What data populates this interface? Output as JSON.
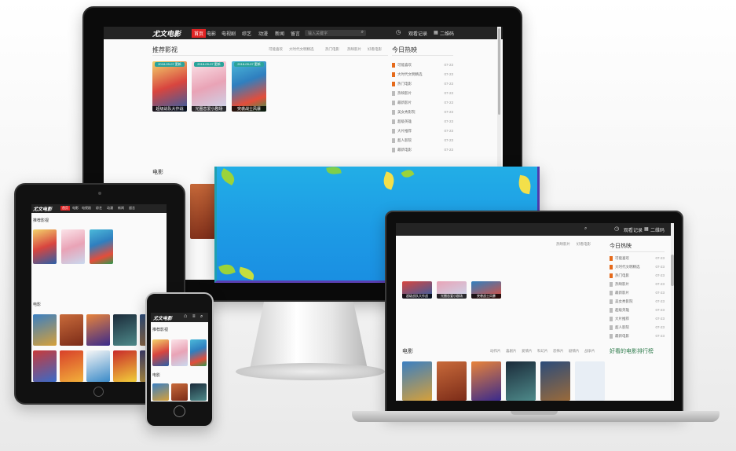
{
  "site": {
    "logo": "尤文电影",
    "nav": [
      "首页",
      "电影",
      "电视剧",
      "综艺",
      "动漫",
      "新闻",
      "留言"
    ],
    "search_placeholder": "输入关键字",
    "history": "观看记录",
    "qrcode": "二维码"
  },
  "recommend": {
    "title": "推荐影视",
    "tags": [
      "可能喜欢",
      "大时代文明精选",
      "热门电影",
      "热映影片",
      "好看电影"
    ],
    "posters": [
      {
        "badge": "2018-09-07 更新",
        "caption": "超级战队大作战"
      },
      {
        "badge": "2018-09-07 更新",
        "caption": "光圈恋爱小剧场"
      },
      {
        "badge": "2018-09-07 更新",
        "caption": "突袭战士风暴"
      }
    ]
  },
  "hot_today": {
    "title": "今日热映",
    "items": [
      {
        "label": "可能喜欢",
        "date": "07-23"
      },
      {
        "label": "大时代文明精选",
        "date": "07-23"
      },
      {
        "label": "热门电影",
        "date": "07-23"
      },
      {
        "label": "热映影片",
        "date": "07-23"
      },
      {
        "label": "最新影片",
        "date": "07-23"
      },
      {
        "label": "美女秀影院",
        "date": "07-23"
      },
      {
        "label": "超级英雄",
        "date": "07-23"
      },
      {
        "label": "大片推荐",
        "date": "07-23"
      },
      {
        "label": "超人影院",
        "date": "07-23"
      },
      {
        "label": "最新电影",
        "date": "07-23"
      }
    ]
  },
  "movie_section": {
    "title": "电影",
    "ranking_title": "好看的电影排行榜",
    "tags": [
      "动作片",
      "喜剧片",
      "爱情片",
      "科幻片",
      "恐怖片",
      "剧情片",
      "战争片"
    ]
  },
  "colors": {
    "nav_bg": "#242424",
    "accent_red": "#e02424",
    "badge_teal": "#2aa39a",
    "hot_orange": "#e56a1b",
    "banner_blue": "#1d9be5"
  },
  "icons": [
    "search-icon",
    "history-icon",
    "qrcode-icon",
    "home-icon",
    "gear-icon"
  ]
}
